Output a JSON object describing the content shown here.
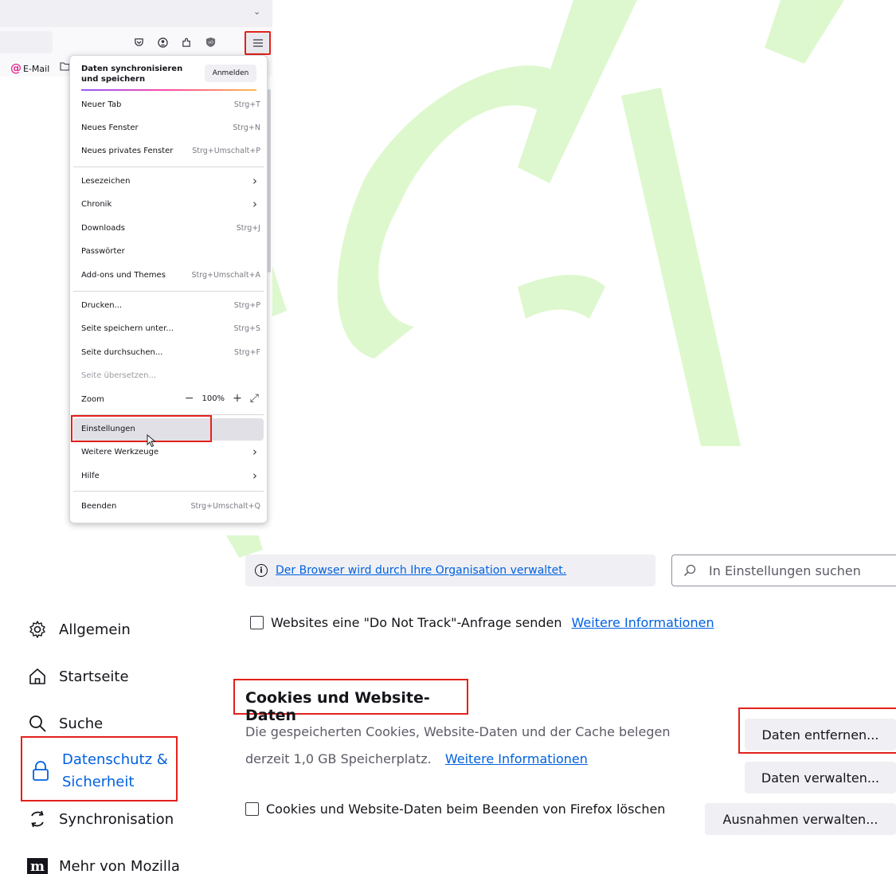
{
  "watermark": {
    "text": "PAGAS"
  },
  "browser": {
    "tabstrip": {
      "chevron": "⌄"
    },
    "toolbar_icons": [
      "pocket-icon",
      "account-icon",
      "extensions-icon",
      "ublock-icon",
      "menu-icon"
    ],
    "bookmarks": [
      {
        "label": "E-Mail",
        "icon": "at-icon"
      },
      {
        "label": "",
        "icon": "folder-icon"
      }
    ],
    "menu": {
      "sync": {
        "text": "Daten synchronisieren und speichern",
        "button": "Anmelden"
      },
      "items": [
        {
          "label": "Neuer Tab",
          "shortcut": "Strg+T"
        },
        {
          "label": "Neues Fenster",
          "shortcut": "Strg+N"
        },
        {
          "label": "Neues privates Fenster",
          "shortcut": "Strg+Umschalt+P"
        },
        {
          "label": "Lesezeichen",
          "shortcut": ""
        },
        {
          "label": "Chronik",
          "shortcut": ""
        },
        {
          "label": "Downloads",
          "shortcut": "Strg+J"
        },
        {
          "label": "Passwörter",
          "shortcut": ""
        },
        {
          "label": "Add-ons und Themes",
          "shortcut": "Strg+Umschalt+A"
        },
        {
          "label": "Drucken...",
          "shortcut": "Strg+P"
        },
        {
          "label": "Seite speichern unter...",
          "shortcut": "Strg+S"
        },
        {
          "label": "Seite durchsuchen...",
          "shortcut": "Strg+F"
        },
        {
          "label": "Seite übersetzen...",
          "shortcut": ""
        },
        {
          "label": "Zoom",
          "shortcut": ""
        },
        {
          "label": "Einstellungen",
          "shortcut": ""
        },
        {
          "label": "Weitere Werkzeuge",
          "shortcut": ""
        },
        {
          "label": "Hilfe",
          "shortcut": ""
        },
        {
          "label": "Beenden",
          "shortcut": "Strg+Umschalt+Q"
        }
      ],
      "zoom": {
        "minus": "−",
        "value": "100%",
        "plus": "+",
        "fullscreen": "⤢"
      }
    }
  },
  "settings": {
    "policy_text": "Der Browser wird durch Ihre Organisation verwaltet.",
    "search_placeholder": "In Einstellungen suchen",
    "sidebar": [
      {
        "label": "Allgemein",
        "icon": "gear-icon"
      },
      {
        "label": "Startseite",
        "icon": "home-icon"
      },
      {
        "label": "Suche",
        "icon": "search-icon"
      },
      {
        "label": "Datenschutz & Sicherheit",
        "label_line1": "Datenschutz &",
        "label_line2": "Sicherheit",
        "icon": "lock-icon"
      },
      {
        "label": "Synchronisation",
        "icon": "sync-icon"
      },
      {
        "label": "Mehr von Mozilla",
        "icon": "mozilla-icon"
      }
    ],
    "dnt": {
      "label": "Websites eine \"Do Not Track\"-Anfrage senden",
      "link": "Weitere Informationen"
    },
    "cookies": {
      "title": "Cookies und Website-Daten",
      "desc_line1": "Die gespeicherten Cookies, Website-Daten und der Cache belegen",
      "desc_line2": "derzeit 1,0 GB Speicherplatz.",
      "link": "Weitere Informationen",
      "delete_on_close": "Cookies und Website-Daten beim Beenden von Firefox löschen",
      "buttons": {
        "remove": "Daten entfernen...",
        "manage": "Daten verwalten...",
        "exceptions": "Ausnahmen verwalten..."
      }
    }
  },
  "colors": {
    "highlight": "#e3211b",
    "link": "#0061e0",
    "watermark": "#d8f7c6"
  }
}
